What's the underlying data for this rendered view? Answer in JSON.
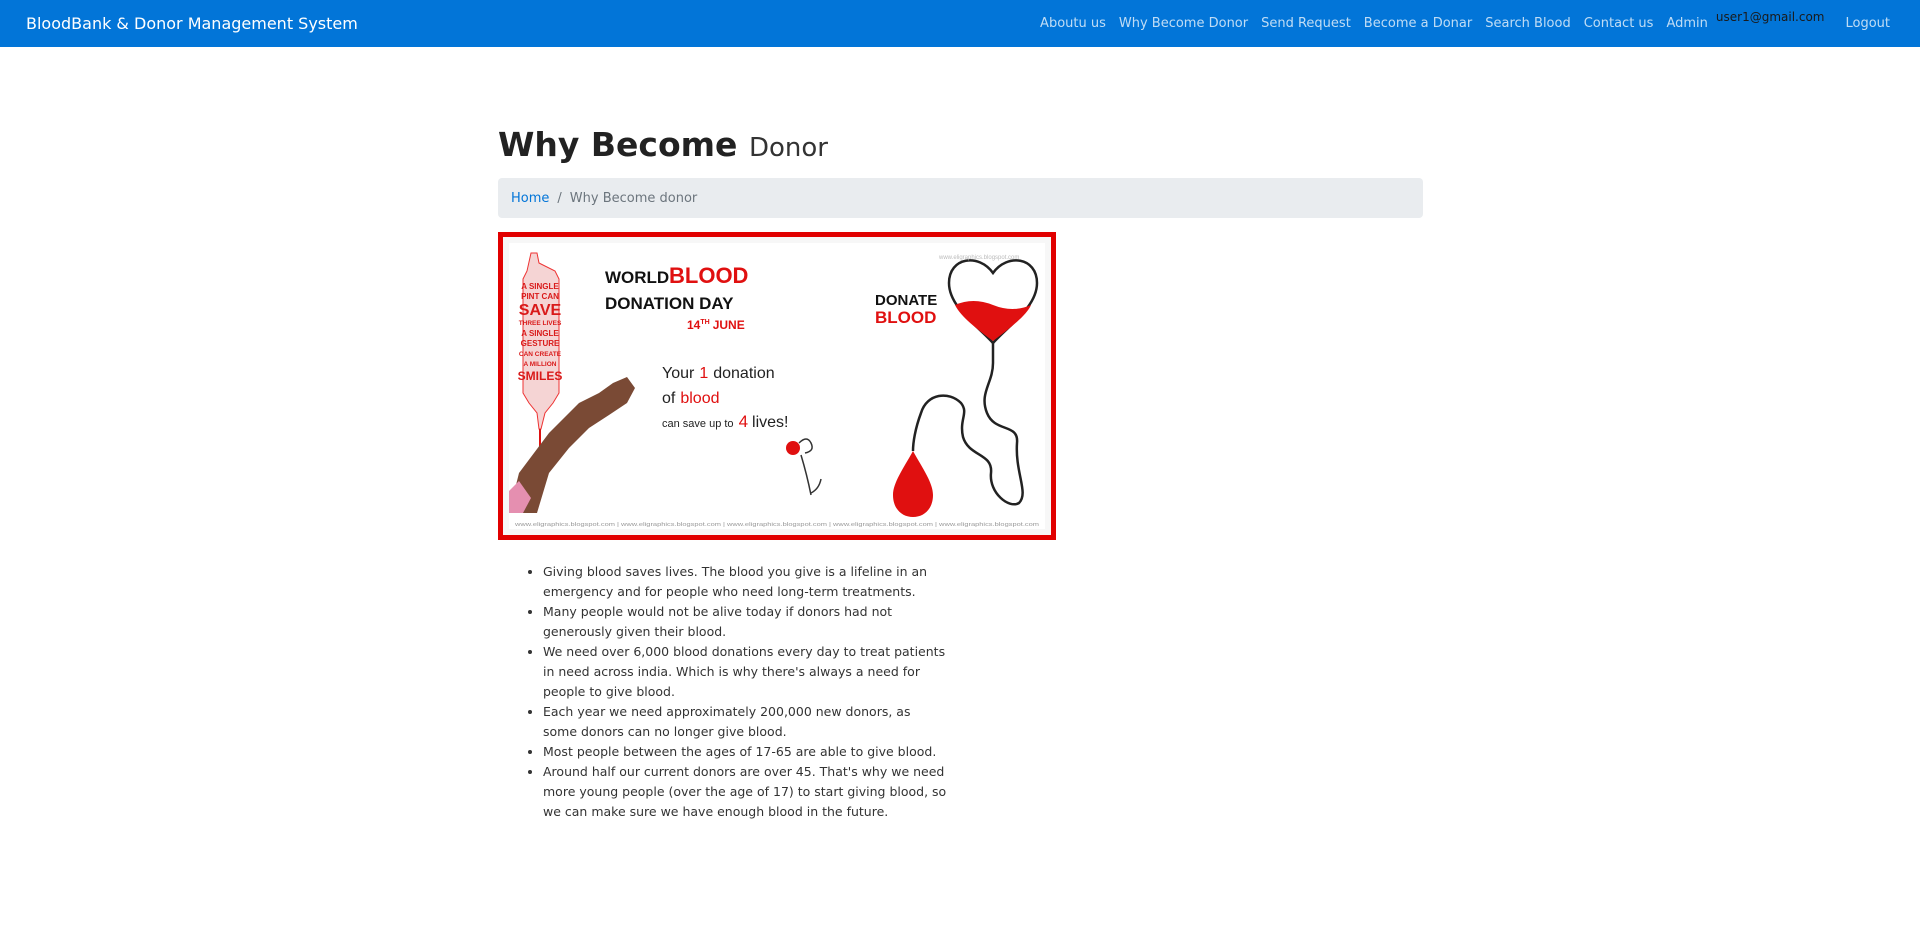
{
  "navbar": {
    "brand": "BloodBank & Donor Management System",
    "links": [
      "Aboutu us",
      "Why Become Donor",
      "Send Request",
      "Become a Donar",
      "Search Blood",
      "Contact us",
      "Admin"
    ],
    "user_email": "user1@gmail.com",
    "logout": "Logout",
    "accent": "#0275d8"
  },
  "page": {
    "title": "Why Become",
    "title_small": "Donor"
  },
  "breadcrumb": {
    "home": "Home",
    "separator": "/",
    "current": "Why Become donor"
  },
  "banner": {
    "border_color": "#e10000",
    "vertical_lines": [
      "A SINGLE",
      "PINT CAN",
      "SAVE",
      "THREE LIVES",
      "A SINGLE",
      "GESTURE",
      "CAN CREATE",
      "A MILLION",
      "SMILES"
    ],
    "world": "WORLD",
    "blood": "BLOOD",
    "donation_day": "DONATION DAY",
    "date": "14",
    "date_sup": "TH",
    "month": "JUNE",
    "your": "Your",
    "one": "1",
    "donation": "donation",
    "of": "of",
    "blood_word": "blood",
    "can_save": "can save up to",
    "four": "4",
    "lives": "lives!",
    "donate": "DONATE",
    "donate_blood": "BLOOD",
    "site": "www.eligraphics.blogspot.com",
    "footer": "www.eligraphics.blogspot.com | www.eligraphics.blogspot.com | www.eligraphics.blogspot.com | www.eligraphics.blogspot.com | www.eligraphics.blogspot.com"
  },
  "facts": [
    "Giving blood saves lives. The blood you give is a lifeline in an emergency and for people who need long-term treatments.",
    "Many people would not be alive today if donors had not generously given their blood.",
    "We need over 6,000 blood donations every day to treat patients in need across india. Which is why there's always a need for people to give blood.",
    "Each year we need approximately 200,000 new donors, as some donors can no longer give blood.",
    "Most people between the ages of 17-65 are able to give blood.",
    "Around half our current donors are over 45. That's why we need more young people (over the age of 17) to start giving blood, so we can make sure we have enough blood in the future."
  ]
}
